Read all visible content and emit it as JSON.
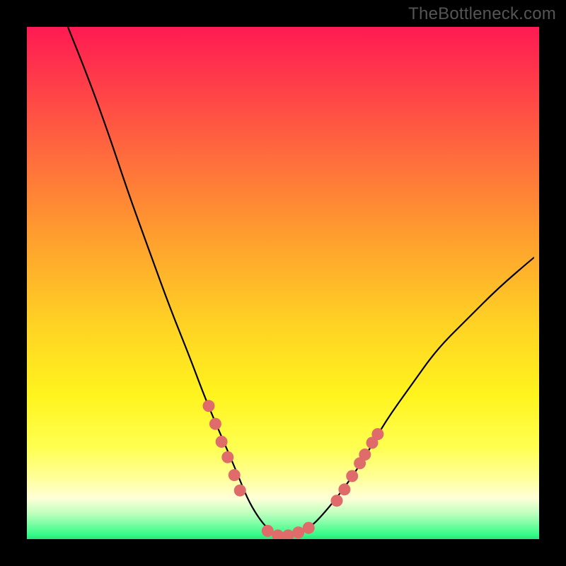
{
  "watermark": "TheBottleneck.com",
  "chart_data": {
    "type": "line",
    "title": "",
    "xlabel": "",
    "ylabel": "",
    "xlim": [
      0,
      100
    ],
    "ylim": [
      0,
      100
    ],
    "grid": false,
    "series": [
      {
        "name": "curve",
        "x": [
          8,
          12,
          16,
          20,
          24,
          28,
          32,
          35,
          38,
          41,
          43,
          45,
          47,
          49,
          52,
          55,
          58,
          62,
          66,
          70,
          75,
          80,
          86,
          92,
          99
        ],
        "y": [
          100,
          90,
          79,
          67,
          56,
          45,
          35,
          27,
          20,
          13,
          8,
          4.5,
          2,
          0.7,
          0.7,
          2,
          5,
          10,
          16,
          23,
          30,
          37,
          43,
          49,
          55
        ]
      }
    ],
    "markers": {
      "name": "marker-dots",
      "color": "#e06b6b",
      "points": [
        {
          "x": 35.5,
          "y": 26
        },
        {
          "x": 36.8,
          "y": 22.5
        },
        {
          "x": 38,
          "y": 19
        },
        {
          "x": 39.2,
          "y": 16
        },
        {
          "x": 40.5,
          "y": 12.5
        },
        {
          "x": 41.6,
          "y": 9.5
        },
        {
          "x": 47,
          "y": 1.6
        },
        {
          "x": 49,
          "y": 0.7
        },
        {
          "x": 51,
          "y": 0.7
        },
        {
          "x": 53,
          "y": 1.3
        },
        {
          "x": 55,
          "y": 2.2
        },
        {
          "x": 60.5,
          "y": 7.5
        },
        {
          "x": 62,
          "y": 9.7
        },
        {
          "x": 63.5,
          "y": 12.3
        },
        {
          "x": 65,
          "y": 14.8
        },
        {
          "x": 66,
          "y": 16.5
        },
        {
          "x": 67.4,
          "y": 18.8
        },
        {
          "x": 68.5,
          "y": 20.5
        }
      ]
    },
    "gradient_stops": [
      {
        "pos": 0,
        "color": "#ff1a53"
      },
      {
        "pos": 0.4,
        "color": "#ff9b2f"
      },
      {
        "pos": 0.72,
        "color": "#fff41e"
      },
      {
        "pos": 0.92,
        "color": "#ffffd8"
      },
      {
        "pos": 1.0,
        "color": "#26e67a"
      }
    ]
  }
}
